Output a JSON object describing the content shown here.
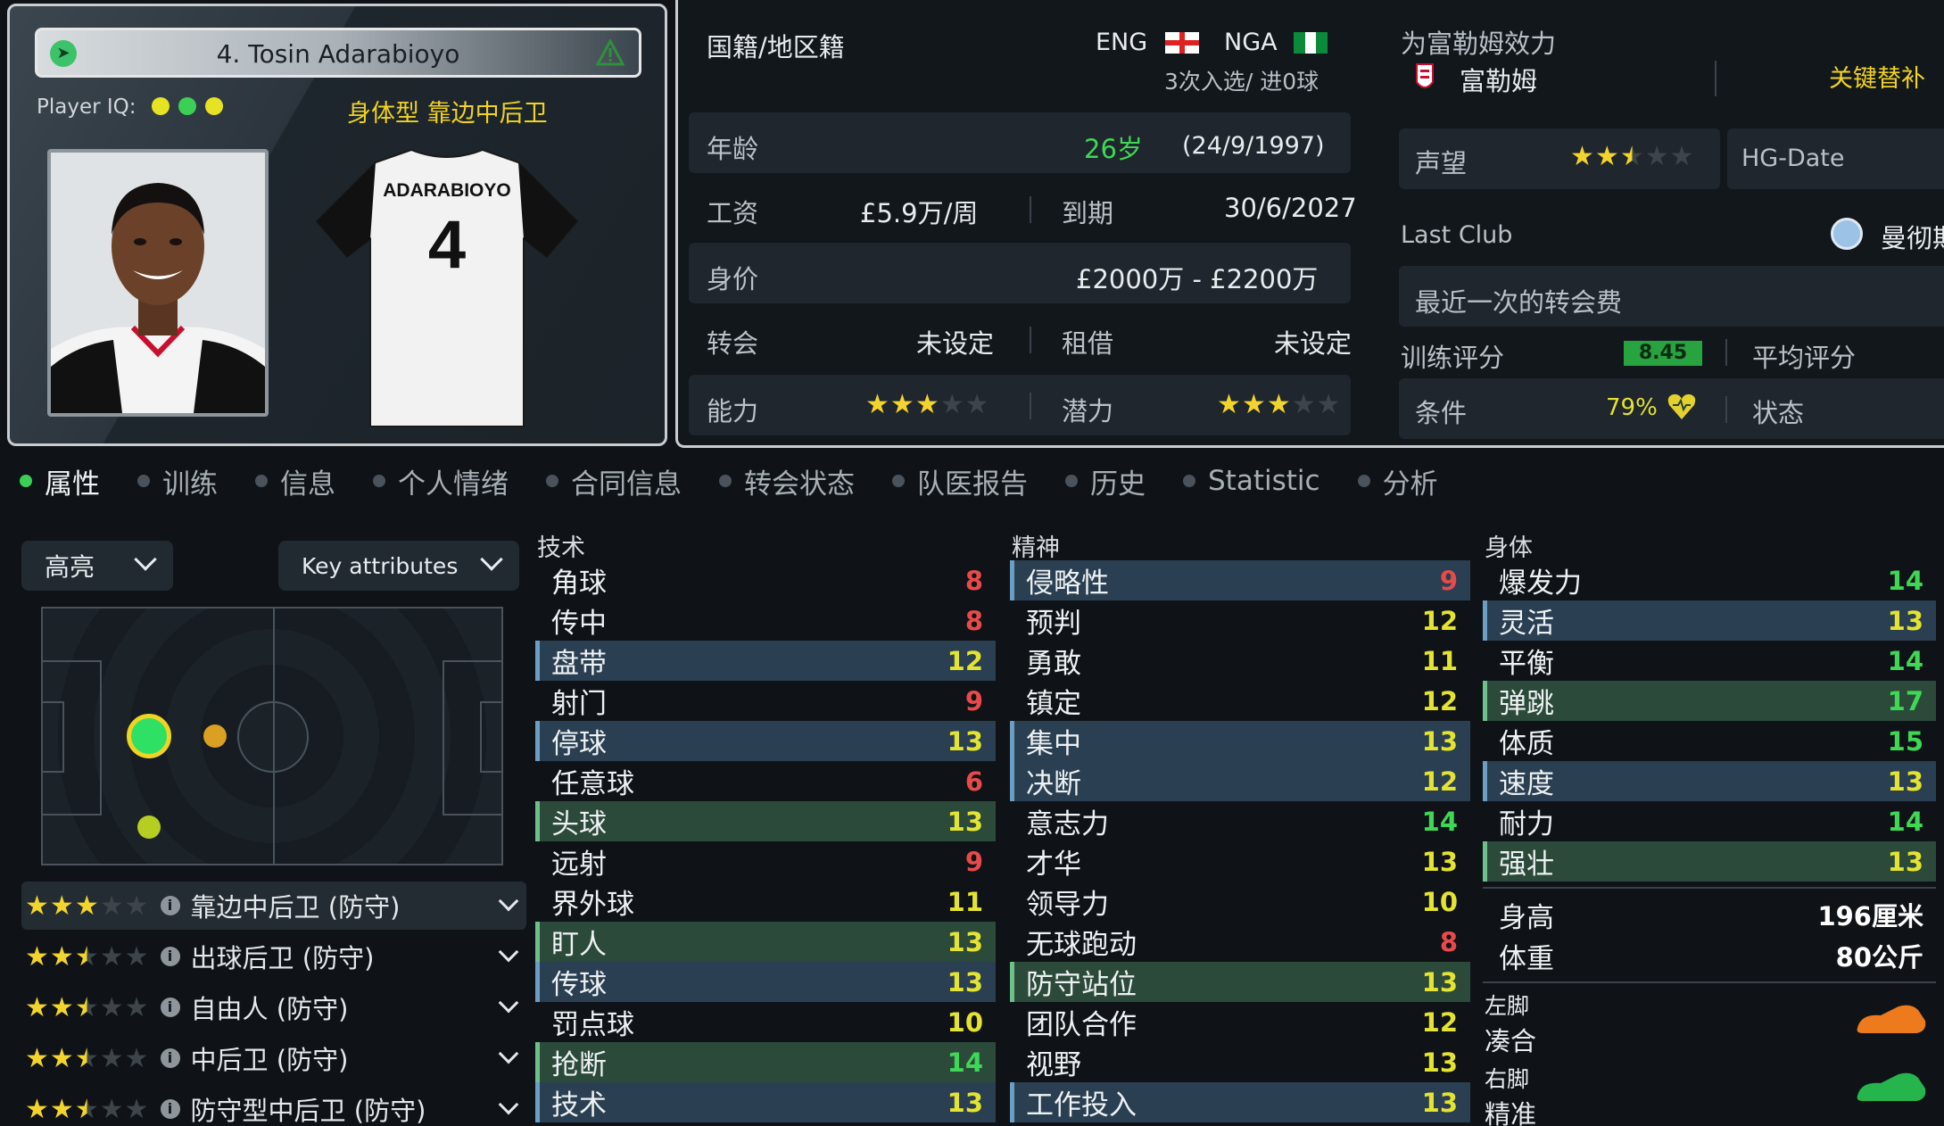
{
  "card": {
    "name": "4. Tosin Adarabioyo",
    "iq_label": "Player IQ:",
    "type_label": "身体型 靠边中后卫",
    "shirt_name": "ADARABIOYO",
    "shirt_number": "4"
  },
  "info": {
    "nationality_label": "国籍/地区籍",
    "nation1": "ENG",
    "nation2": "NGA",
    "caps": "3次入选/ 进0球",
    "age_label": "年龄",
    "age": "26岁",
    "dob": "(24/9/1997)",
    "wage_label": "工资",
    "wage": "£5.9万/周",
    "expiry_label": "到期",
    "expiry": "30/6/2027",
    "value_label": "身价",
    "value": "£2000万 - £2200万",
    "transfer_label": "转会",
    "transfer": "未设定",
    "loan_label": "租借",
    "loan": "未设定",
    "ability_label": "能力",
    "ability_stars": 3,
    "potential_label": "潜力",
    "potential_stars": 3,
    "plays_for_label": "为富勒姆效力",
    "club": "富勒姆",
    "squad_status": "关键替补",
    "reputation_label": "声望",
    "reputation_stars": 2.5,
    "hg_label": "HG-Date",
    "last_club_label": "Last Club",
    "last_club": "曼彻斯",
    "last_fee_label": "最近一次的转会费",
    "training_label": "训练评分",
    "training_value": "8.45",
    "avg_rating_label": "平均评分",
    "condition_label": "条件",
    "condition_value": "79%",
    "status_label": "状态"
  },
  "tabs": [
    "属性",
    "训练",
    "信息",
    "个人情绪",
    "合同信息",
    "转会状态",
    "队医报告",
    "历史",
    "Statistic",
    "分析"
  ],
  "left": {
    "highlight_dropdown": "高亮",
    "key_dropdown": "Key attributes",
    "roles": [
      {
        "name": "靠边中后卫 (防守)",
        "stars": 3
      },
      {
        "name": "出球后卫 (防守)",
        "stars": 2.5
      },
      {
        "name": "自由人 (防守)",
        "stars": 2.5
      },
      {
        "name": "中后卫 (防守)",
        "stars": 2.5
      },
      {
        "name": "防守型中后卫 (防守)",
        "stars": 2.5
      }
    ]
  },
  "attributes": {
    "technical_header": "技术",
    "technical": [
      {
        "name": "角球",
        "value": "8",
        "hl": ""
      },
      {
        "name": "传中",
        "value": "8",
        "hl": ""
      },
      {
        "name": "盘带",
        "value": "12",
        "hl": "blue"
      },
      {
        "name": "射门",
        "value": "9",
        "hl": ""
      },
      {
        "name": "停球",
        "value": "13",
        "hl": "blue"
      },
      {
        "name": "任意球",
        "value": "6",
        "hl": ""
      },
      {
        "name": "头球",
        "value": "13",
        "hl": "green"
      },
      {
        "name": "远射",
        "value": "9",
        "hl": ""
      },
      {
        "name": "界外球",
        "value": "11",
        "hl": ""
      },
      {
        "name": "盯人",
        "value": "13",
        "hl": "green"
      },
      {
        "name": "传球",
        "value": "13",
        "hl": "blue"
      },
      {
        "name": "罚点球",
        "value": "10",
        "hl": ""
      },
      {
        "name": "抢断",
        "value": "14",
        "hl": "green"
      },
      {
        "name": "技术",
        "value": "13",
        "hl": "blue"
      }
    ],
    "mental_header": "精神",
    "mental": [
      {
        "name": "侵略性",
        "value": "9",
        "hl": "blue"
      },
      {
        "name": "预判",
        "value": "12",
        "hl": ""
      },
      {
        "name": "勇敢",
        "value": "11",
        "hl": ""
      },
      {
        "name": "镇定",
        "value": "12",
        "hl": ""
      },
      {
        "name": "集中",
        "value": "13",
        "hl": "blue"
      },
      {
        "name": "决断",
        "value": "12",
        "hl": "blue"
      },
      {
        "name": "意志力",
        "value": "14",
        "hl": ""
      },
      {
        "name": "才华",
        "value": "13",
        "hl": ""
      },
      {
        "name": "领导力",
        "value": "10",
        "hl": ""
      },
      {
        "name": "无球跑动",
        "value": "8",
        "hl": ""
      },
      {
        "name": "防守站位",
        "value": "13",
        "hl": "green"
      },
      {
        "name": "团队合作",
        "value": "12",
        "hl": ""
      },
      {
        "name": "视野",
        "value": "13",
        "hl": ""
      },
      {
        "name": "工作投入",
        "value": "13",
        "hl": "blue"
      }
    ],
    "physical_header": "身体",
    "physical": [
      {
        "name": "爆发力",
        "value": "14",
        "hl": ""
      },
      {
        "name": "灵活",
        "value": "13",
        "hl": "blue"
      },
      {
        "name": "平衡",
        "value": "14",
        "hl": ""
      },
      {
        "name": "弹跳",
        "value": "17",
        "hl": "green"
      },
      {
        "name": "体质",
        "value": "15",
        "hl": ""
      },
      {
        "name": "速度",
        "value": "13",
        "hl": "blue"
      },
      {
        "name": "耐力",
        "value": "14",
        "hl": ""
      },
      {
        "name": "强壮",
        "value": "13",
        "hl": "green"
      }
    ],
    "height_label": "身高",
    "height": "196厘米",
    "weight_label": "体重",
    "weight": "80公斤",
    "left_foot_label": "左脚",
    "left_foot": "凑合",
    "right_foot_label": "右脚",
    "right_foot": "精准"
  },
  "colors": {
    "accent_green": "#3ccf55",
    "value_red": "#e84a4a",
    "value_yellow": "#e4e330",
    "star": "#f3d42c"
  }
}
